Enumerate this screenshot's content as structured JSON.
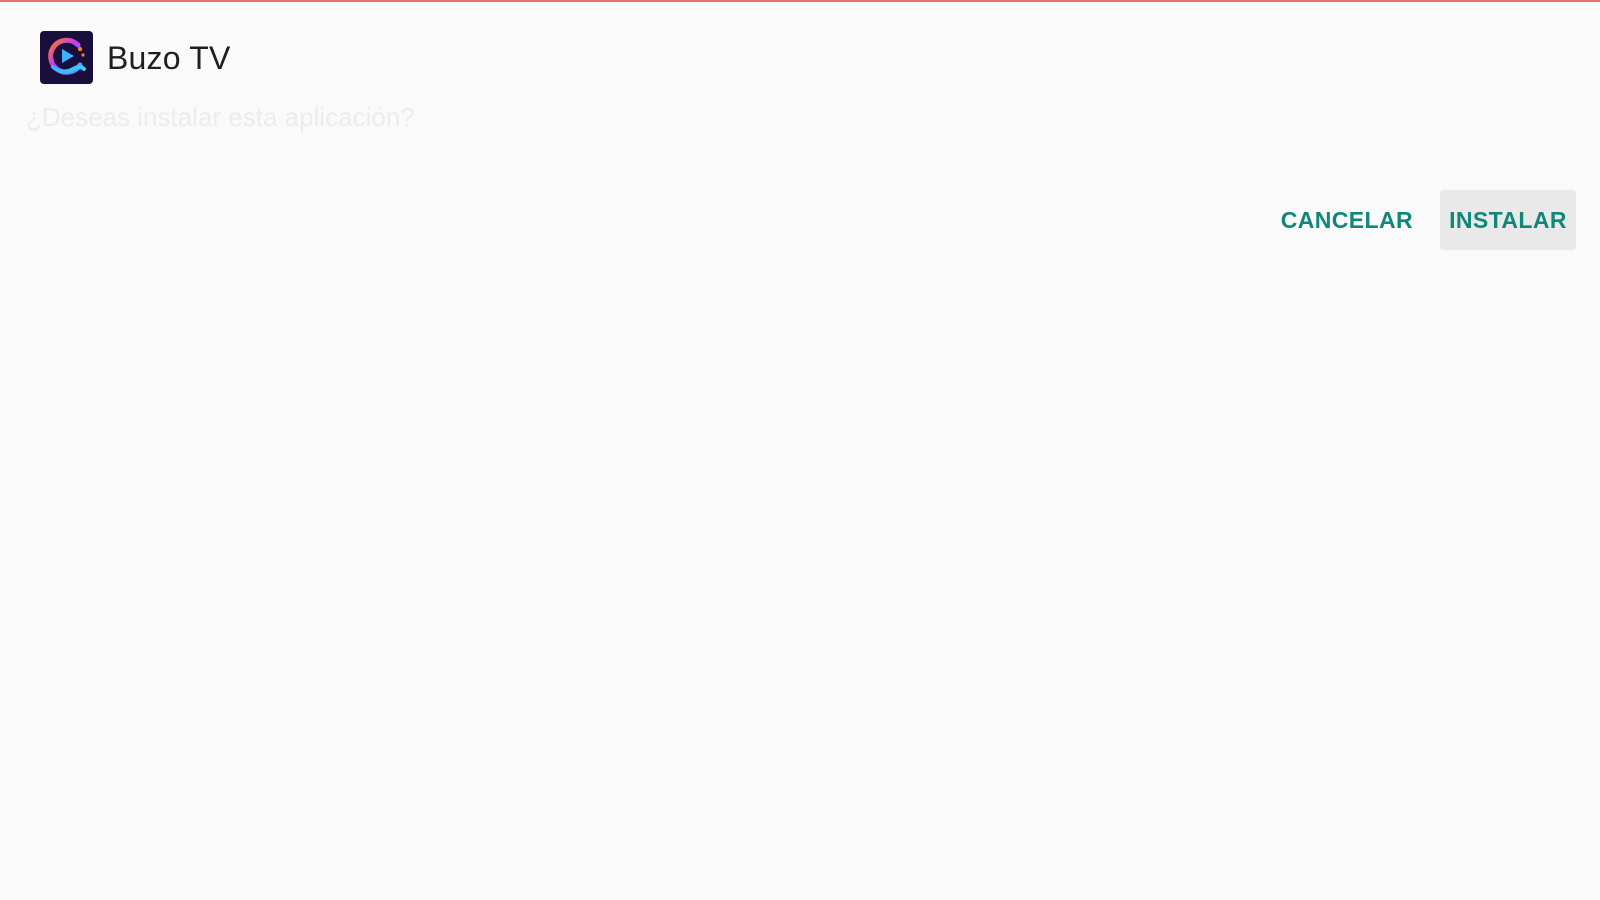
{
  "app": {
    "name": "Buzo TV",
    "icon": "buzo-tv-app-icon",
    "icon_colors": [
      "#1a0f3a",
      "#ff7a1a",
      "#3bb0ff",
      "#c238ff"
    ]
  },
  "dialog": {
    "question": "¿Deseas instalar esta aplicación?",
    "cancel_label": "CANCELAR",
    "install_label": "INSTALAR",
    "accent_color": "#11877a"
  }
}
